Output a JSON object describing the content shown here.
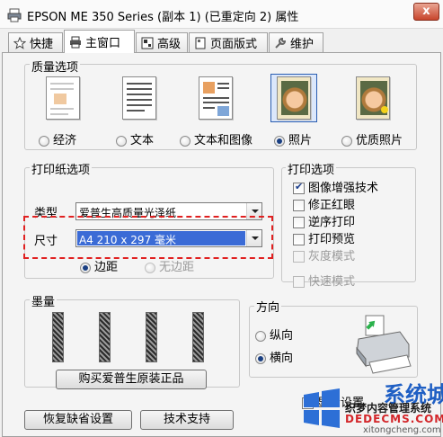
{
  "window": {
    "title": "EPSON ME 350 Series (副本 1) (已重定向 2) 属性",
    "close_label": "x"
  },
  "tabs": [
    {
      "label": "快捷",
      "icon": "star-icon"
    },
    {
      "label": "主窗口",
      "icon": "printer-icon",
      "active": true
    },
    {
      "label": "高级",
      "icon": "grid-icon"
    },
    {
      "label": "页面版式",
      "icon": "page-icon"
    },
    {
      "label": "维护",
      "icon": "wrench-icon"
    }
  ],
  "quality": {
    "label": "质量选项",
    "options": [
      {
        "label": "经济",
        "selected": false
      },
      {
        "label": "文本",
        "selected": false
      },
      {
        "label": "文本和图像",
        "selected": false
      },
      {
        "label": "照片",
        "selected": true
      },
      {
        "label": "优质照片",
        "selected": false
      }
    ]
  },
  "paper": {
    "label": "打印纸选项",
    "type_label": "类型",
    "type_value": "爱普生高质量光泽纸",
    "size_label": "尺寸",
    "size_value": "A4 210 x 297 毫米",
    "margin_label": "边距",
    "no_margin_label": "无边距",
    "margin_selected": true
  },
  "print_options": {
    "label": "打印选项",
    "items": [
      {
        "label": "图像增强技术",
        "checked": true,
        "enabled": true
      },
      {
        "label": "修正红眼",
        "checked": false,
        "enabled": true
      },
      {
        "label": "逆序打印",
        "checked": false,
        "enabled": true
      },
      {
        "label": "打印预览",
        "checked": false,
        "enabled": true
      },
      {
        "label": "灰度模式",
        "checked": false,
        "enabled": false
      }
    ],
    "quick_mode_label": "快速模式"
  },
  "ink": {
    "label": "墨量",
    "buy_label": "购买爱普生原装正品"
  },
  "orientation": {
    "label": "方向",
    "portrait_label": "纵向",
    "landscape_label": "横向",
    "landscape_selected": true
  },
  "bottom": {
    "restore_label": "恢复缺省设置",
    "support_label": "技术支持",
    "show_label_partial": "显示设置"
  },
  "watermark": {
    "title": "系统城",
    "subtitle": "织梦内容管理系统",
    "domain": "DEDECMS.COM",
    "small": "xitongcheng.com"
  },
  "colors": {
    "highlight": "#3b6bd6",
    "red_dashed": "#e02020",
    "accent": "#1a3f82"
  }
}
